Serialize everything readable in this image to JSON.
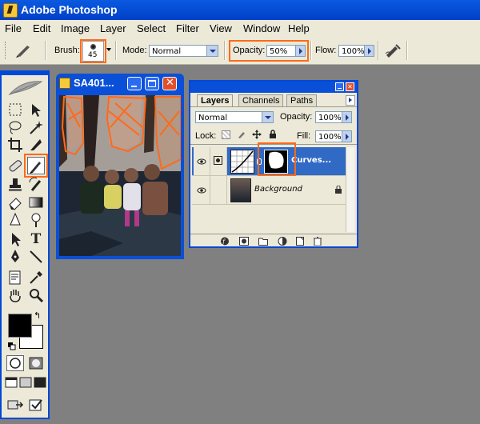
{
  "app": {
    "title": "Adobe Photoshop"
  },
  "menu": [
    "File",
    "Edit",
    "Image",
    "Layer",
    "Select",
    "Filter",
    "View",
    "Window",
    "Help"
  ],
  "options": {
    "brush_label": "Brush:",
    "brush_size": "45",
    "mode_label": "Mode:",
    "mode_value": "Normal",
    "opacity_label": "Opacity:",
    "opacity_value": "50%",
    "flow_label": "Flow:",
    "flow_value": "100%"
  },
  "document": {
    "title": "SA401..."
  },
  "layers_panel": {
    "tabs": [
      "Layers",
      "Channels",
      "Paths"
    ],
    "blend_mode": "Normal",
    "opacity_label": "Opacity:",
    "opacity_value": "100%",
    "lock_label": "Lock:",
    "fill_label": "Fill:",
    "fill_value": "100%",
    "layers": [
      {
        "name": "Curves...",
        "selected": true
      },
      {
        "name": "Background",
        "selected": false
      }
    ]
  },
  "colors": {
    "highlight": "#ff6a1a",
    "xp_blue": "#0a4fd8",
    "selected_layer": "#316ac5"
  }
}
